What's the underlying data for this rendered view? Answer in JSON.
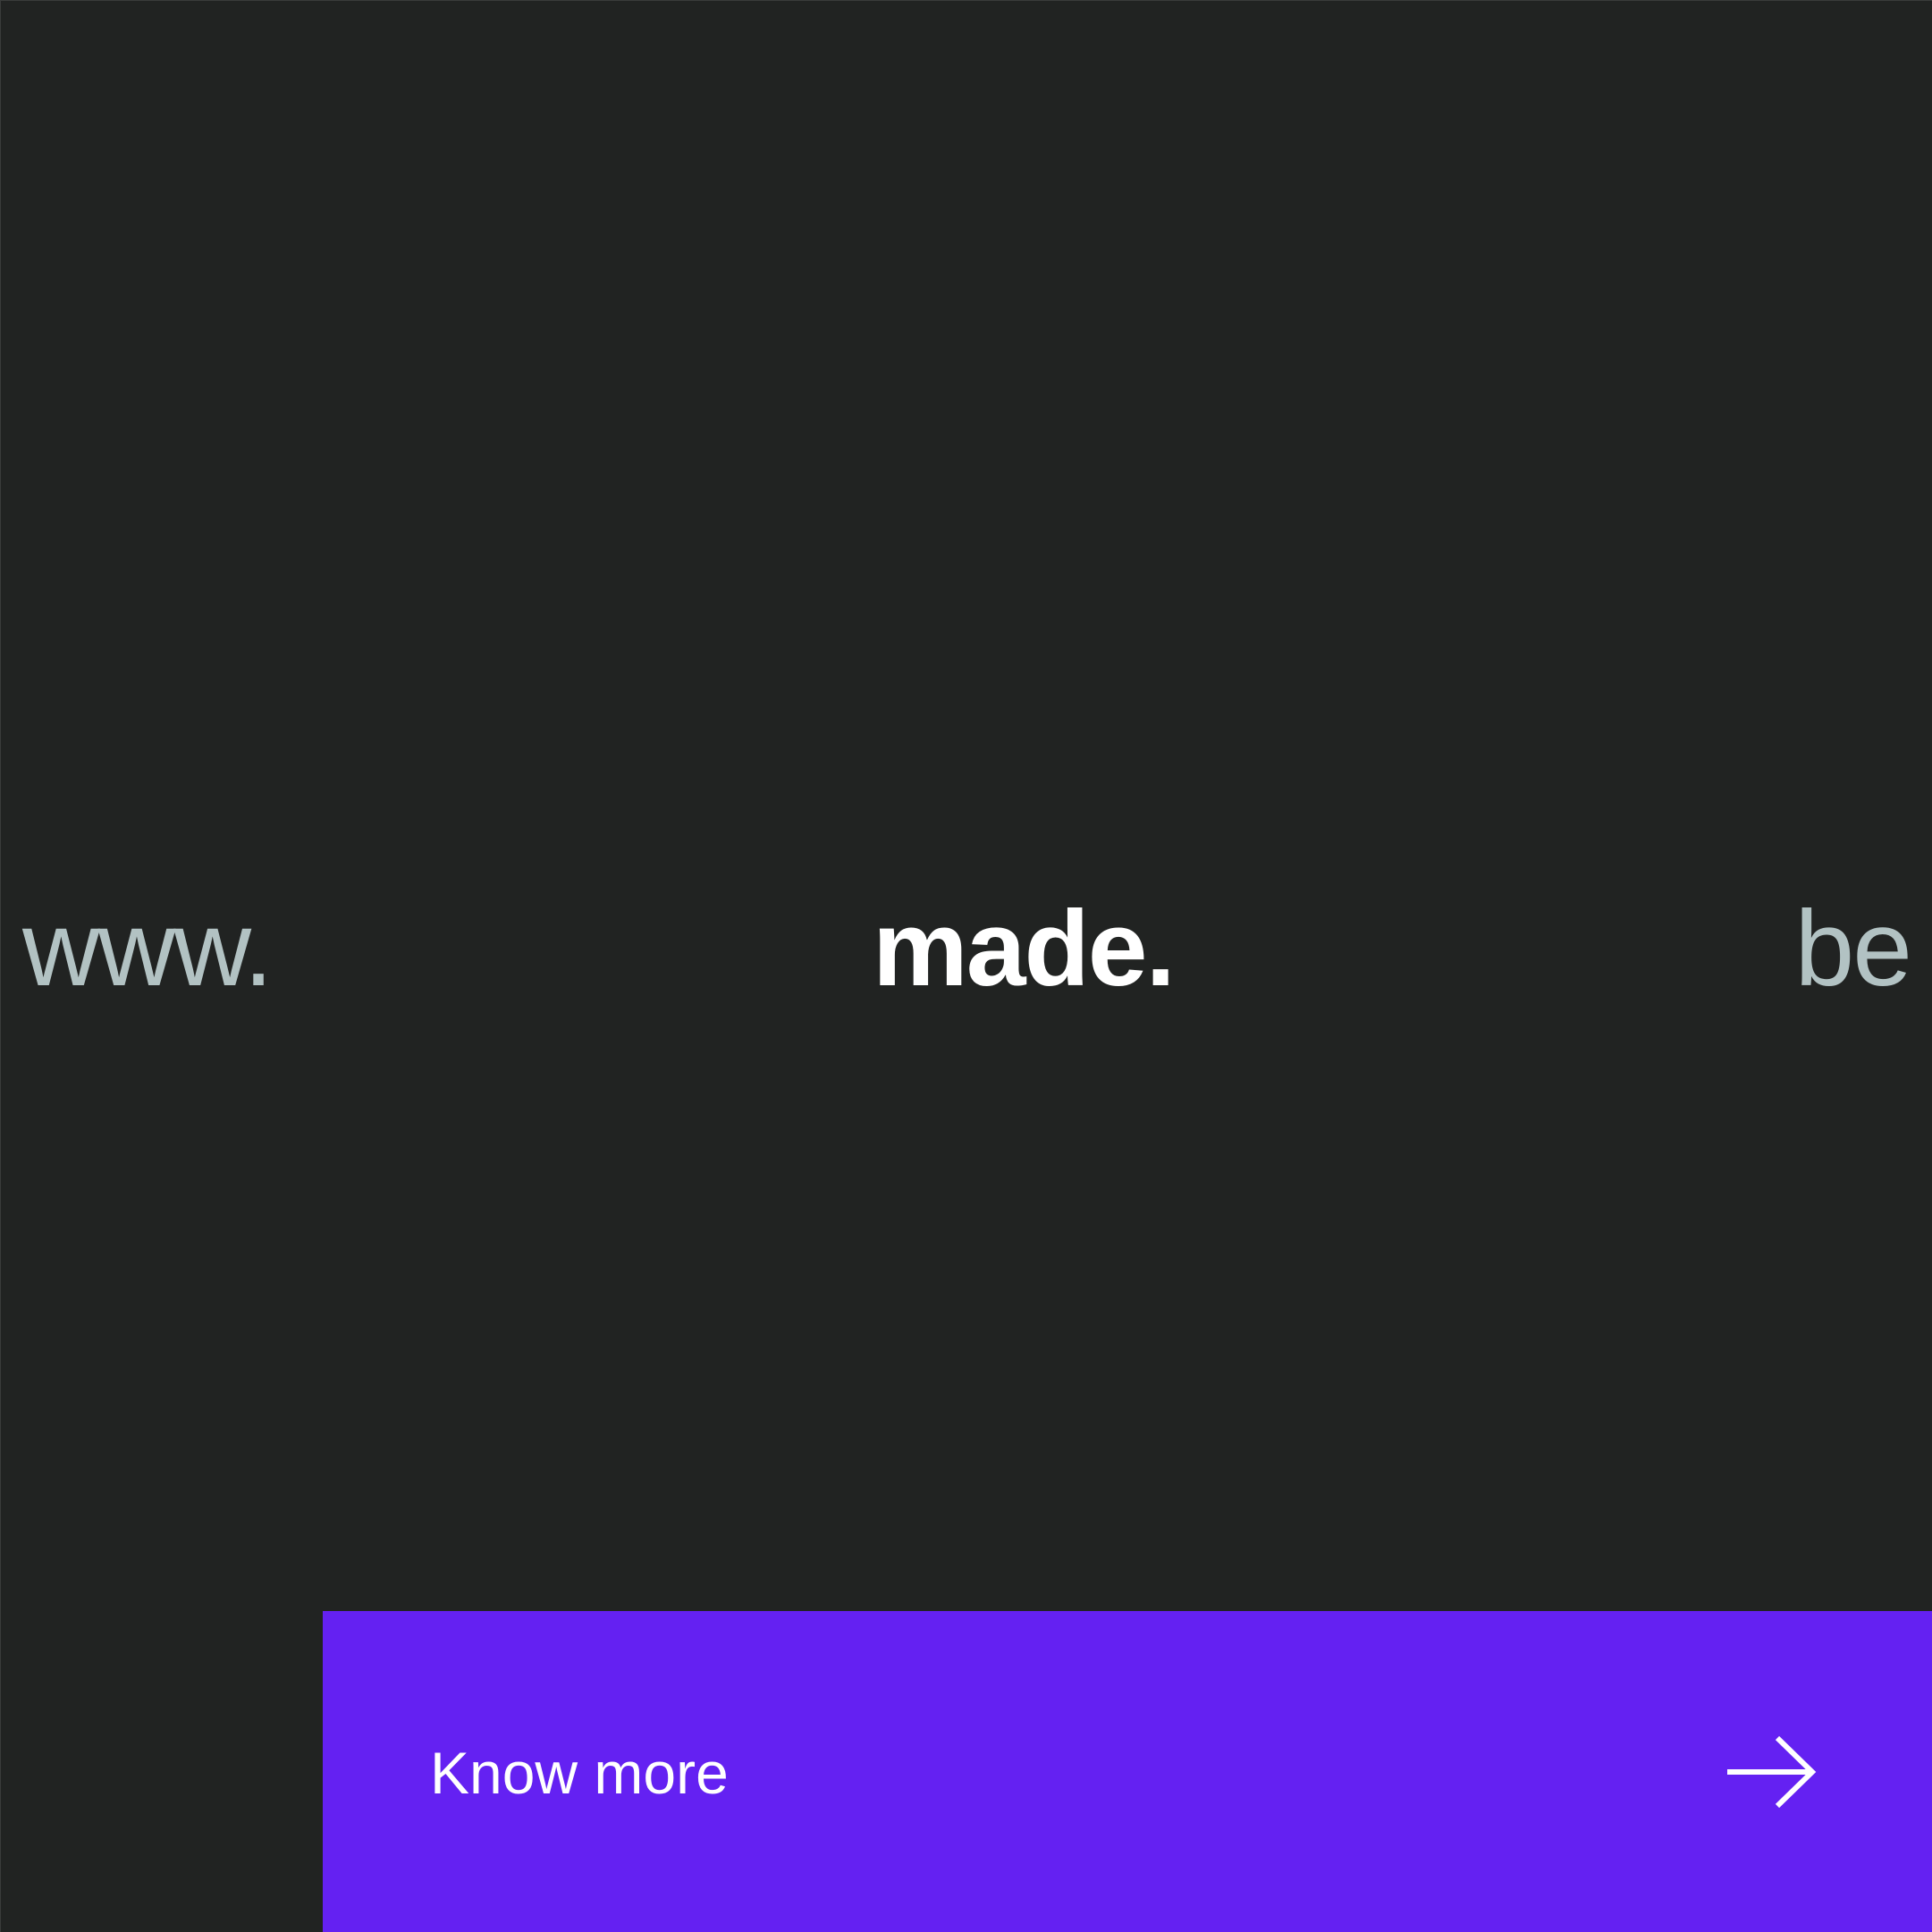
{
  "domain": {
    "prefix": "www.",
    "name": "made.",
    "suffix": "be"
  },
  "cta": {
    "label": "Know more",
    "icon": "arrow-right-icon"
  },
  "colors": {
    "background": "#212322",
    "muted_text": "#b2c2c3",
    "primary_text": "#ffffff",
    "accent": "#6421f2"
  }
}
